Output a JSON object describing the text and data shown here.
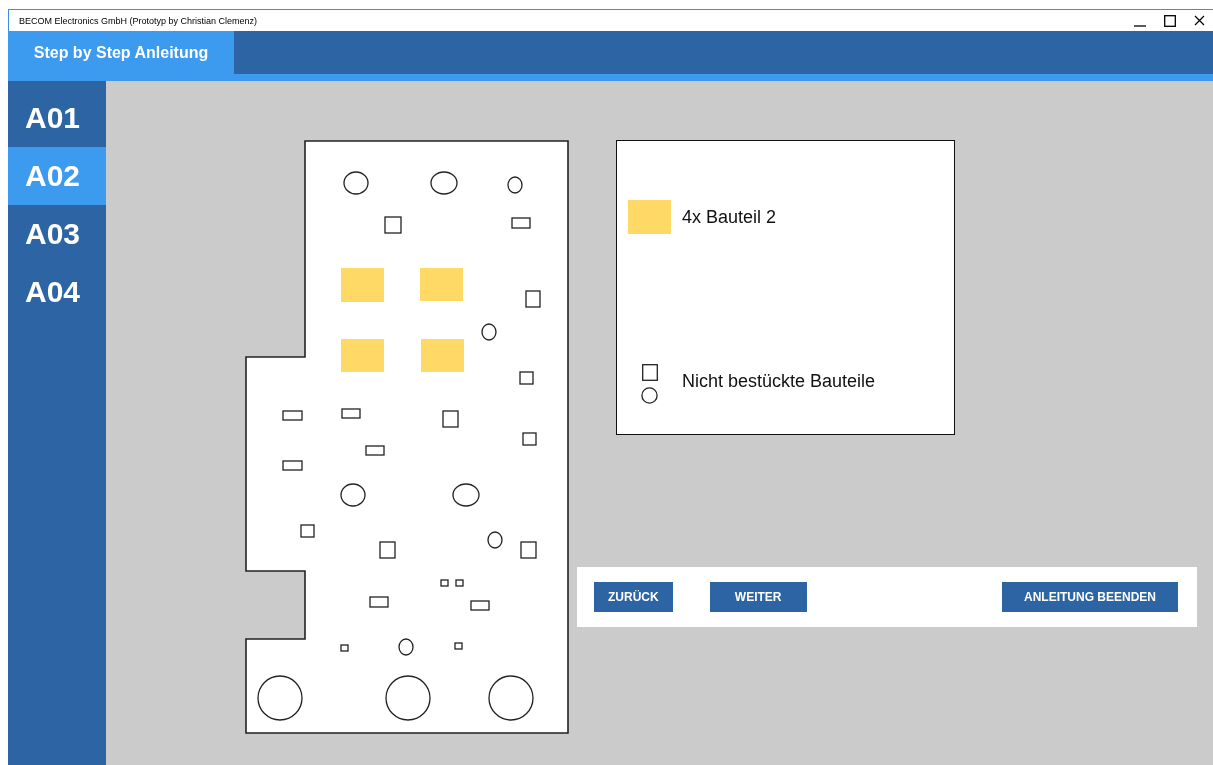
{
  "window": {
    "title": "BECOM Electronics GmbH (Prototyp by Christian Clemenz)"
  },
  "tabs": [
    {
      "label": "Step by Step Anleitung",
      "selected": true
    }
  ],
  "steps": [
    {
      "label": "A01",
      "selected": false
    },
    {
      "label": "A02",
      "selected": true
    },
    {
      "label": "A03",
      "selected": false
    },
    {
      "label": "A04",
      "selected": false
    }
  ],
  "legend": [
    {
      "kind": "swatch",
      "label": "4x Bauteil 2",
      "color": "#ffd966"
    },
    {
      "kind": "outline",
      "label": "Nicht bestückte Bauteile"
    }
  ],
  "buttons": [
    {
      "label": "ZURÜCK"
    },
    {
      "label": "WEITER"
    },
    {
      "label": "ANLEITUNG BEENDEN"
    }
  ]
}
